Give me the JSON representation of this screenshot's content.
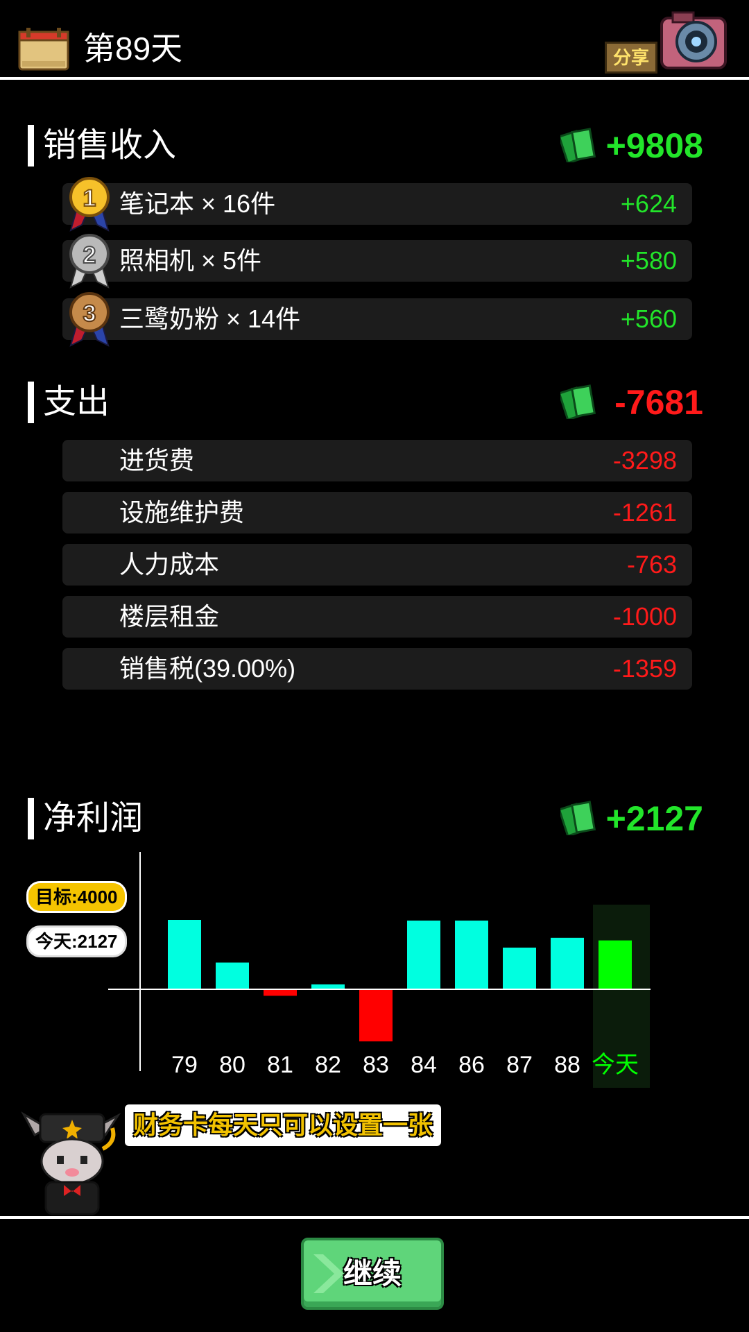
{
  "header": {
    "day_title": "第89天",
    "share_label": "分享",
    "icons": [
      "calendar-icon",
      "camera-icon"
    ]
  },
  "income": {
    "title": "销售收入",
    "total": "+9808",
    "rows": [
      {
        "rank": "1",
        "label": "笔记本 × 16件",
        "value": "+624"
      },
      {
        "rank": "2",
        "label": "照相机 × 5件",
        "value": "+580"
      },
      {
        "rank": "3",
        "label": "三鹭奶粉 × 14件",
        "value": "+560"
      }
    ]
  },
  "expense": {
    "title": "支出",
    "total": "-7681",
    "rows": [
      {
        "label": "进货费",
        "value": "-3298"
      },
      {
        "label": "设施维护费",
        "value": "-1261"
      },
      {
        "label": "人力成本",
        "value": "-763"
      },
      {
        "label": "楼层租金",
        "value": "-1000"
      },
      {
        "label": "销售税(39.00%)",
        "value": "-1359"
      }
    ]
  },
  "profit": {
    "title": "净利润",
    "total": "+2127",
    "target_label": "目标:4000",
    "today_label": "今天:2127"
  },
  "chart_data": {
    "type": "bar",
    "categories": [
      "79",
      "80",
      "81",
      "82",
      "83",
      "84",
      "86",
      "87",
      "88",
      "今天"
    ],
    "values": [
      2130,
      820,
      -200,
      150,
      -1600,
      2110,
      2110,
      1280,
      1580,
      1500
    ],
    "highlight_index": 9,
    "colors": {
      "positive": "#00ffe0",
      "negative": "#ff0000",
      "highlight": "#00ff00",
      "highlight_bg": "#0b1c0b"
    }
  },
  "tip": {
    "text": "财务卡每天只可以设置一张"
  },
  "footer": {
    "continue_label": "继续"
  },
  "colors": {
    "positive": "#22e52a",
    "negative": "#ff1a1a",
    "row_bg": "#1c1c1c",
    "target_badge": "#f5c400"
  }
}
